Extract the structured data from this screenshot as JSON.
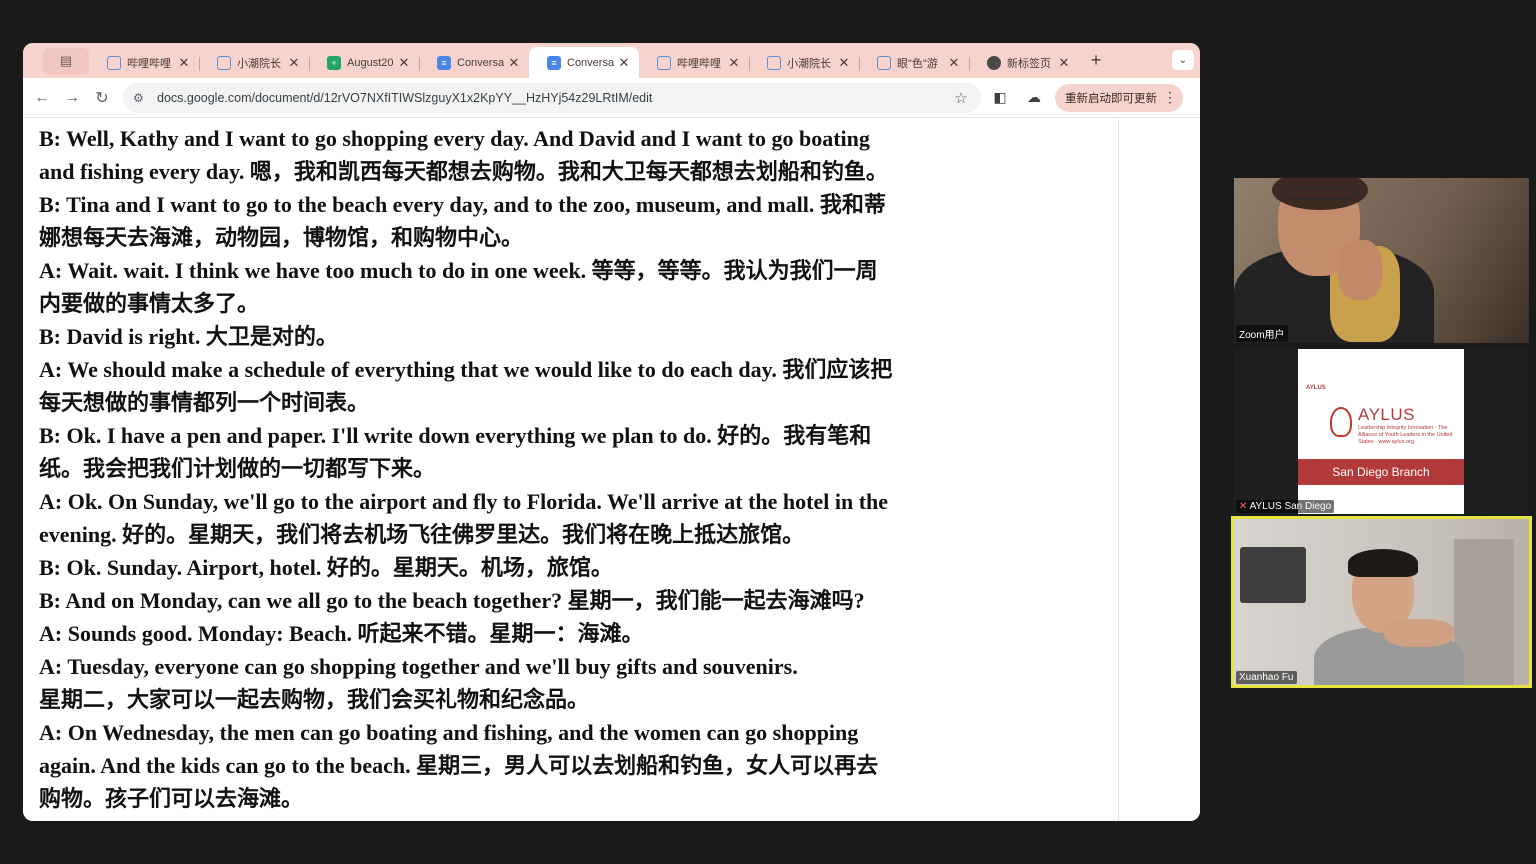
{
  "browser": {
    "tabs": [
      {
        "icon": "bilibili-icon",
        "title": "哔哩哔哩",
        "active": false
      },
      {
        "icon": "bilibili-icon",
        "title": "小潮院长",
        "active": false
      },
      {
        "icon": "sheets-icon",
        "title": "August20",
        "active": false
      },
      {
        "icon": "docs-icon",
        "title": "Conversa",
        "active": false
      },
      {
        "icon": "docs-icon",
        "title": "Conversa",
        "active": true
      },
      {
        "icon": "bilibili-icon",
        "title": "哔哩哔哩",
        "active": false
      },
      {
        "icon": "bilibili-icon",
        "title": "小潮院长",
        "active": false
      },
      {
        "icon": "bilibili-icon",
        "title": "眼\"色\"游",
        "active": false
      },
      {
        "icon": "chrome-icon",
        "title": "新标签页",
        "active": false
      }
    ],
    "new_tab_symbol": "+",
    "url": "docs.google.com/document/d/12rVO7NXfITIWSlzguyX1x2KpYY__HzHYj54z29LRtIM/edit",
    "update_label": "重新启动即可更新",
    "theme_color": "#f6d3cd"
  },
  "document": {
    "lines": [
      "B: Well, Kathy and I want to go shopping every day. And David and I want to go boating",
      "and fishing every day. 嗯，我和凯西每天都想去购物。我和大卫每天都想去划船和钓鱼。",
      "B: Tina and I want to go to the beach every day, and to the zoo, museum, and mall. 我和蒂",
      "娜想每天去海滩，动物园，博物馆，和购物中心。",
      "A: Wait. wait. I think we have too much to do in one week. 等等，等等。我认为我们一周",
      "内要做的事情太多了。",
      "B: David is right. 大卫是对的。",
      "A: We should make a schedule of everything that we would like to do each day. 我们应该把",
      "每天想做的事情都列一个时间表。",
      "B: Ok. I have a pen and paper. I'll write down everything we plan to do. 好的。我有笔和",
      "纸。我会把我们计划做的一切都写下来。",
      "A: Ok. On Sunday, we'll go to the airport and fly to Florida. We'll arrive at the hotel in the",
      "evening. 好的。星期天，我们将去机场飞往佛罗里达。我们将在晚上抵达旅馆。",
      "B: Ok. Sunday. Airport, hotel. 好的。星期天。机场，旅馆。",
      "B: And on Monday, can we all go to the beach together? 星期一，我们能一起去海滩吗?",
      "A: Sounds good. Monday: Beach. 听起来不错。星期一：海滩。",
      "A: Tuesday, everyone can go shopping together and we'll buy gifts and souvenirs.",
      "星期二，大家可以一起去购物，我们会买礼物和纪念品。",
      "A: On Wednesday, the men can go boating and fishing, and the women can go shopping",
      "again. And the kids can go to the beach. 星期三，男人可以去划船和钓鱼，女人可以再去",
      "购物。孩子们可以去海滩。"
    ]
  },
  "participants": [
    {
      "name": "Zoom用户"
    },
    {
      "name": "AYLUS San Diego",
      "muted": true,
      "card": {
        "small": "AYLUS",
        "logo_text": "AYLUS",
        "tagline": "Leadership Integrity Innovation · The Alliance of Youth Leaders in the United States · www.aylus.org",
        "branch": "San Diego Branch"
      }
    },
    {
      "name": "Xuanhao Fu",
      "active_speaker": true,
      "highlight_color": "#e6e53f"
    }
  ]
}
